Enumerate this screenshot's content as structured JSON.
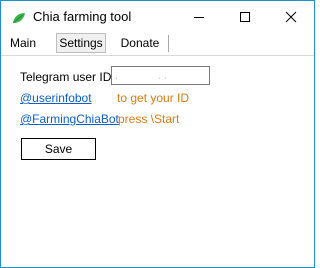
{
  "window": {
    "title": "Chia farming tool",
    "icon": "leaf-icon",
    "controls": [
      "minimize-icon",
      "maximize-icon",
      "close-icon"
    ]
  },
  "tabs": [
    {
      "label": "Main",
      "selected": false
    },
    {
      "label": "Settings",
      "selected": true
    },
    {
      "label": "Donate",
      "selected": false
    }
  ],
  "settings": {
    "telegram_label": "Telegram user ID:",
    "telegram_value": ".             . .",
    "userinfobot_link": "@userinfobot",
    "userinfobot_hint": "to get your ID",
    "farmingbot_link": "@FarmingChiaBot",
    "farmingbot_hint": "press \\Start",
    "save_label": "Save"
  },
  "colors": {
    "accent_border": "#1e90c8",
    "link": "#0b5fcf",
    "hint": "#e07a12",
    "leaf": "#3cb44b"
  }
}
